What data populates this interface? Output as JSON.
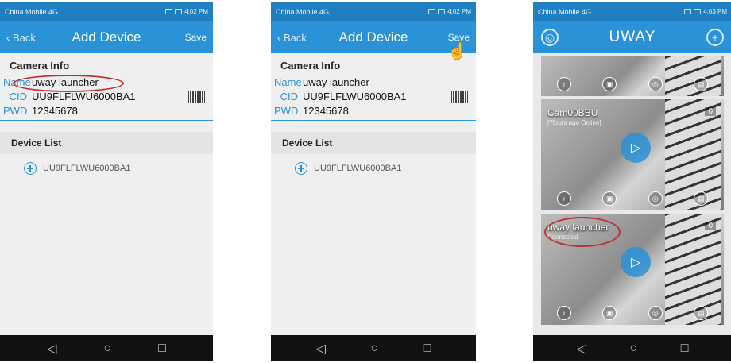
{
  "status": {
    "carrier": "China Mobile 4G",
    "time1": "4:02 PM",
    "time2": "4:02 PM",
    "time3": "4:03 PM"
  },
  "add_device": {
    "back_label": "Back",
    "title": "Add Device",
    "save_label": "Save",
    "camera_info_header": "Camera Info",
    "name_label": "Name",
    "name_value": "uway launcher",
    "cid_label": "CID",
    "cid_value": "UU9FLFLWU6000BA1",
    "pwd_label": "PWD",
    "pwd_value": "12345678",
    "device_list_header": "Device List",
    "device_item": "UU9FLFLWU6000BA1"
  },
  "uway": {
    "title": "UWAY",
    "cameras": [
      {
        "name": "",
        "status": "",
        "count": ""
      },
      {
        "name": "Cam00BBU",
        "status": "[?]ours ago Online]",
        "count": "0"
      },
      {
        "name": "uway launcher",
        "status": "Connected",
        "count": "0"
      }
    ]
  },
  "sysnav": {
    "back": "◁",
    "home": "○",
    "recent": "□"
  }
}
